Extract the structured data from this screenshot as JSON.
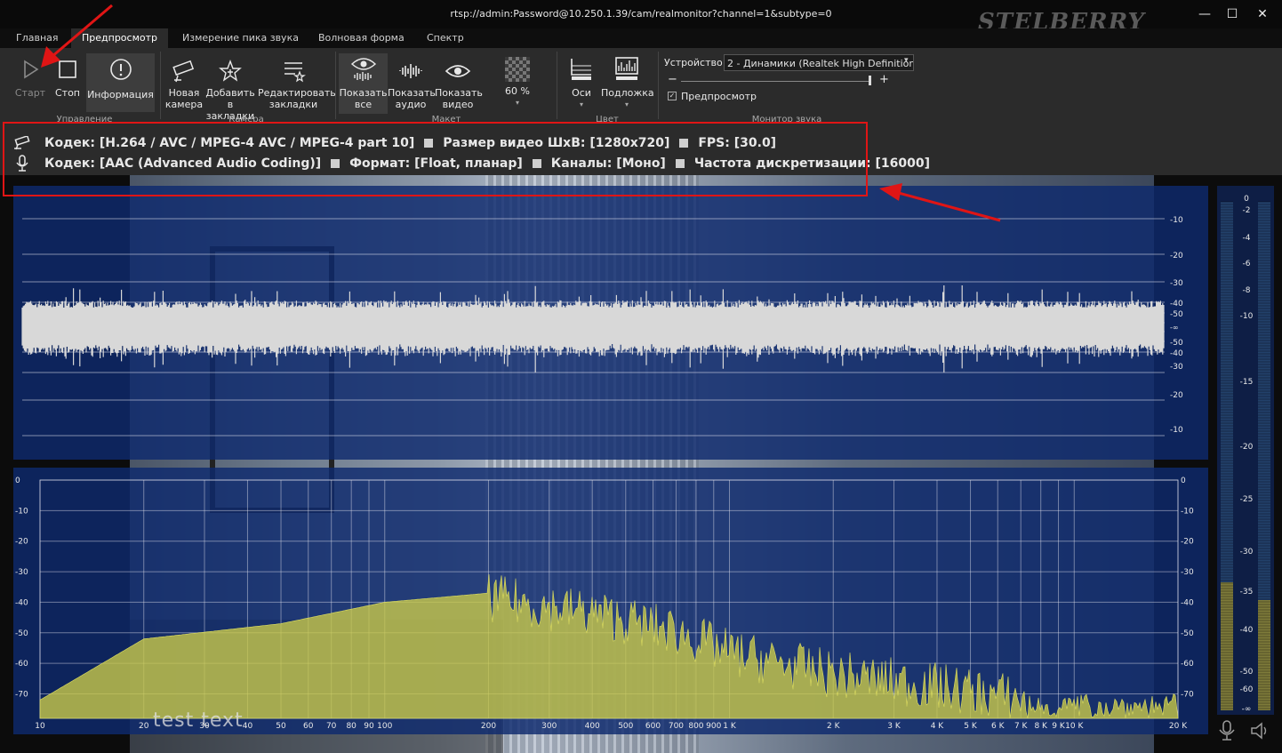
{
  "window": {
    "title": "rtsp://admin:Password@10.250.1.39/cam/realmonitor?channel=1&subtype=0",
    "logo": "STELBERRY",
    "min_glyph": "—",
    "max_glyph": "☐",
    "close_glyph": "✕"
  },
  "tabs": [
    "Главная",
    "Предпросмотр",
    "Измерение пика звука",
    "Волновая форма",
    "Спектр"
  ],
  "ribbon": {
    "start": "Старт",
    "stop": "Стоп",
    "info": "Информация",
    "new_camera_1": "Новая",
    "new_camera_2": "камера",
    "bookmark_1": "Добавить",
    "bookmark_2": "в закладки",
    "edit_bm_1": "Редактировать",
    "edit_bm_2": "закладки",
    "show_all_1": "Показать",
    "show_all_2": "все",
    "show_audio_1": "Показать",
    "show_audio_2": "аудио",
    "show_video_1": "Показать",
    "show_video_2": "видео",
    "zoom": "60 %",
    "axes": "Оси",
    "underlay": "Подложка",
    "device_label": "Устройство:",
    "device_value": "2 - Динамики (Realtek High Definition",
    "preview_check": "Предпросмотр",
    "minus": "−",
    "plus": "+",
    "groups": {
      "control": "Управление",
      "camera": "Камера",
      "layout": "Макет",
      "color": "Цвет",
      "monitor": "Монитор звука"
    }
  },
  "info": {
    "video_codec": "Кодек: [H.264 / AVC / MPEG-4 AVC / MPEG-4 part 10]",
    "video_size": "Размер видео ШxВ: [1280x720]",
    "fps": "FPS: [30.0]",
    "audio_codec": "Кодек: [AAC (Advanced Audio Coding)]",
    "audio_format": "Формат: [Float, планар]",
    "channels": "Каналы: [Моно]",
    "sample_rate": "Частота дискретизации: [16000]"
  },
  "overlay_text": "test text",
  "colors": {
    "accent_red": "#e01515",
    "spectrum_fill": "#c9c94a",
    "panel_blue": "#0e2a6e",
    "meter_yellow": "#7d7a3a"
  },
  "waveform": {
    "db_labels_top": [
      "-10",
      "-20",
      "-30",
      "-40",
      "-50"
    ],
    "center_label": "-∞",
    "db_labels_bottom": [
      "-50",
      "-40",
      "-30",
      "-20",
      "-10"
    ]
  },
  "spectrum": {
    "db_labels": [
      "0",
      "-10",
      "-20",
      "-30",
      "-40",
      "-50",
      "-60",
      "-70"
    ],
    "freq_labels": [
      "10",
      "20",
      "30",
      "40",
      "50",
      "60",
      "70",
      "80",
      "90",
      "100",
      "200",
      "300",
      "400",
      "500",
      "600",
      "700",
      "800",
      "900",
      "1 K",
      "2 K",
      "3 K",
      "4 K",
      "5 K",
      "6 K",
      "7 K",
      "8 K",
      "9 K",
      "10 K",
      "20 K"
    ]
  },
  "meter": {
    "labels": [
      "0",
      "-2",
      "-4",
      "-6",
      "-8",
      "-10",
      "-15",
      "-20",
      "-25",
      "-30",
      "-35",
      "-40",
      "-50",
      "-60",
      "-∞"
    ],
    "level_db": -34
  }
}
